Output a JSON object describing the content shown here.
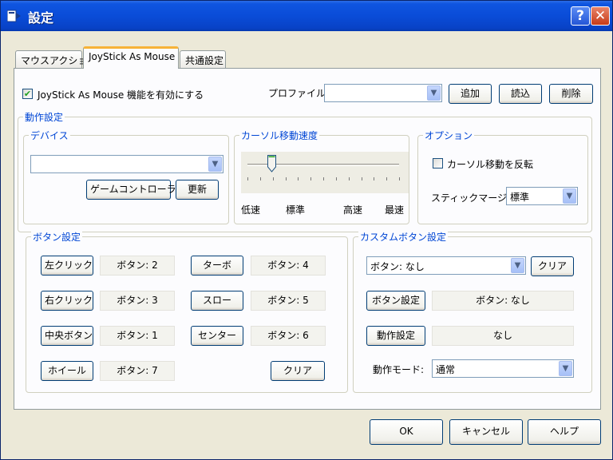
{
  "window": {
    "title": "設定",
    "help_glyph": "?",
    "close_glyph": "✕"
  },
  "tabs": [
    {
      "label": "マウスアクション"
    },
    {
      "label": "JoyStick As Mouse"
    },
    {
      "label": "共通設定"
    }
  ],
  "enable": {
    "label": "JoyStick As Mouse 機能を有効にする",
    "checked": true
  },
  "profile": {
    "label": "プロファイル:",
    "value": "",
    "add": "追加",
    "load": "読込",
    "delete": "削除"
  },
  "motion": {
    "title": "動作設定",
    "device": {
      "title": "デバイス",
      "value": "",
      "game_controller": "ゲームコントローラ",
      "refresh": "更新"
    },
    "speed": {
      "title": "カーソル移動速度",
      "labels": [
        "低速",
        "標準",
        "高速",
        "最速"
      ],
      "level": 0.16
    },
    "option": {
      "title": "オプション",
      "invert_label": "カーソル移動を反転",
      "invert_checked": false,
      "margin_label": "スティックマージン",
      "margin_value": "標準"
    }
  },
  "buttons": {
    "title": "ボタン設定",
    "items": [
      {
        "label": "左クリック",
        "value": "ボタン: 2"
      },
      {
        "label": "右クリック",
        "value": "ボタン: 3"
      },
      {
        "label": "中央ボタン",
        "value": "ボタン: 1"
      },
      {
        "label": "ホイール",
        "value": "ボタン: 7"
      },
      {
        "label": "ターボ",
        "value": "ボタン: 4"
      },
      {
        "label": "スロー",
        "value": "ボタン: 5"
      },
      {
        "label": "センター",
        "value": "ボタン: 6"
      }
    ],
    "clear": "クリア"
  },
  "custom": {
    "title": "カスタムボタン設定",
    "select_value": "ボタン: なし",
    "clear": "クリア",
    "button_setting": "ボタン設定",
    "button_value": "ボタン: なし",
    "action_setting": "動作設定",
    "action_value": "なし",
    "mode_label": "動作モード:",
    "mode_value": "通常"
  },
  "footer": {
    "ok": "OK",
    "cancel": "キャンセル",
    "help": "ヘルプ"
  },
  "colors": {
    "title_bar": "#0A4CD8",
    "group_label": "#0046D5",
    "button_border": "#003C74",
    "active_tab_accent": "#F7B338"
  }
}
